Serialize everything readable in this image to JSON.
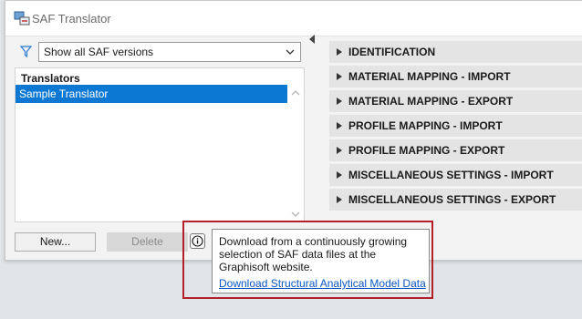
{
  "window": {
    "title": "SAF Translator"
  },
  "icons": {
    "app": "saf-translator-icon",
    "filter": "filter-icon",
    "dropdown": "chevron-down-icon",
    "info": "info-icon",
    "scroll_up": "scroll-up-icon",
    "scroll_down": "scroll-down-icon",
    "collapse": "chevron-left-icon",
    "expand": "triangle-right-icon"
  },
  "filter": {
    "selected": "Show all SAF versions"
  },
  "translators": {
    "header": "Translators",
    "items": [
      {
        "label": "Sample Translator",
        "selected": true
      }
    ]
  },
  "buttons": {
    "new": "New...",
    "delete": "Delete"
  },
  "sections": [
    {
      "label": "IDENTIFICATION"
    },
    {
      "label": "MATERIAL MAPPING - IMPORT"
    },
    {
      "label": "MATERIAL MAPPING - EXPORT"
    },
    {
      "label": "PROFILE MAPPING - IMPORT"
    },
    {
      "label": "PROFILE MAPPING - EXPORT"
    },
    {
      "label": "MISCELLANEOUS SETTINGS - IMPORT"
    },
    {
      "label": "MISCELLANEOUS SETTINGS - EXPORT"
    }
  ],
  "tooltip": {
    "text": "Download from a continuously growing selection of SAF data files at the Graphisoft website.",
    "link": "Download Structural Analytical Model Data"
  },
  "colors": {
    "selection": "#0c78d4",
    "section_bg": "#e4e4e4",
    "highlight": "#b3202a",
    "link": "#0a56c2"
  }
}
